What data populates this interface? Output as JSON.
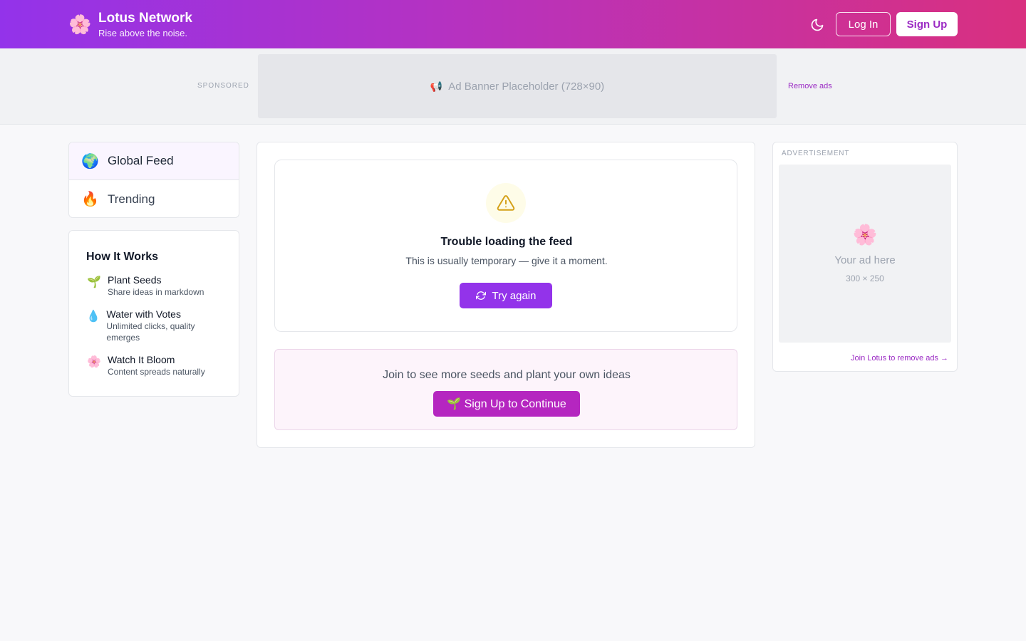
{
  "header": {
    "logo_icon": "🌸",
    "title": "Lotus Network",
    "tagline": "Rise above the noise.",
    "theme_toggle_icon": "moon-icon",
    "login_label": "Log In",
    "signup_label": "Sign Up"
  },
  "top_ad": {
    "sponsored_label": "SPONSORED",
    "banner_icon": "📢",
    "banner_text": "Ad Banner Placeholder (728×90)",
    "remove_ads_label": "Remove ads"
  },
  "sidebar": {
    "nav": [
      {
        "icon": "🌍",
        "label": "Global Feed",
        "active": true
      },
      {
        "icon": "🔥",
        "label": "Trending",
        "active": false
      }
    ],
    "how_it_works": {
      "title": "How It Works",
      "steps": [
        {
          "icon": "🌱",
          "title": "Plant Seeds",
          "desc": "Share ideas in markdown"
        },
        {
          "icon": "💧",
          "title": "Water with Votes",
          "desc": "Unlimited clicks, quality emerges"
        },
        {
          "icon": "🌸",
          "title": "Watch It Bloom",
          "desc": "Content spreads naturally"
        }
      ]
    }
  },
  "main": {
    "error": {
      "icon": "warning-icon",
      "title": "Trouble loading the feed",
      "description": "This is usually temporary — give it a moment.",
      "retry_label": "Try again"
    },
    "join": {
      "text": "Join to see more seeds and plant your own ideas",
      "button_label": "🌱 Sign Up to Continue"
    }
  },
  "right_ad": {
    "label": "ADVERTISEMENT",
    "icon": "🌸",
    "text": "Your ad here",
    "size": "300 × 250",
    "join_label": "Join Lotus to remove ads →"
  },
  "colors": {
    "brand_purple": "#9333ea",
    "brand_pink": "#d9307f",
    "join_button": "#b526c0"
  }
}
